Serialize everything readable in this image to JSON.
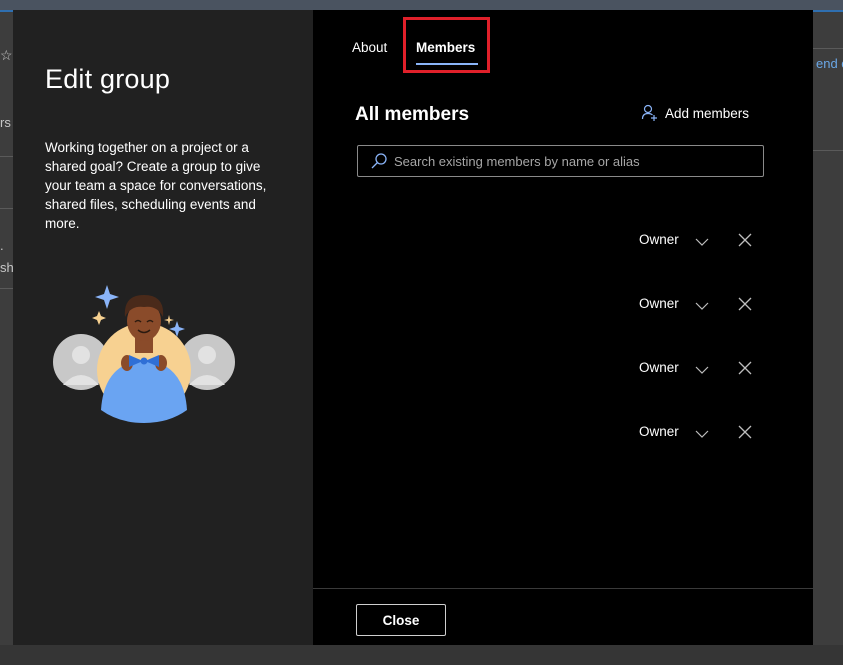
{
  "background": {
    "left_text_1": "rs",
    "left_text_2": ".",
    "left_text_3": "sh",
    "right_link": "end c"
  },
  "dialog": {
    "title": "Edit group",
    "description": "Working together on a project or a shared goal? Create a group to give your team a space for conversations, shared files, scheduling events and more.",
    "tabs": [
      {
        "label": "About",
        "selected": false
      },
      {
        "label": "Members",
        "selected": true
      }
    ],
    "section_title": "All members",
    "add_members_label": "Add members",
    "search": {
      "placeholder": "Search existing members by name or alias",
      "value": ""
    },
    "members": [
      {
        "role": "Owner"
      },
      {
        "role": "Owner"
      },
      {
        "role": "Owner"
      },
      {
        "role": "Owner"
      }
    ],
    "close_label": "Close"
  },
  "colors": {
    "accent": "#8ab4f8",
    "highlight_box": "#e0202a",
    "left_panel_bg": "#212121",
    "dialog_bg": "#000000"
  }
}
